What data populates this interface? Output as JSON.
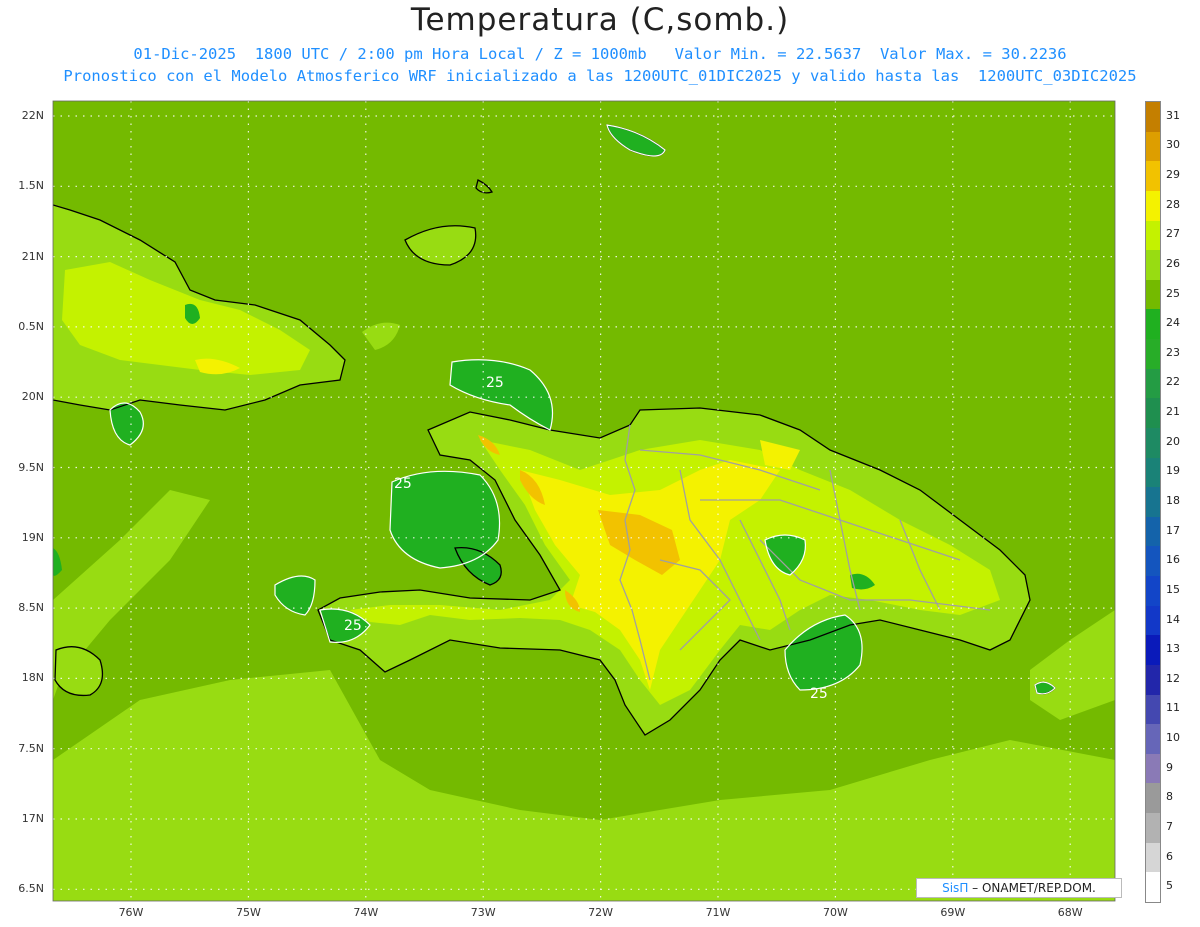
{
  "title": "Temperatura (C,somb.)",
  "subtitle_line1": "01-Dic-2025  1800 UTC / 2:00 pm Hora Local / Z = 1000mb   Valor Min. = 22.5637  Valor Max. = 30.2236",
  "subtitle_line2": "Pronostico con el Modelo Atmosferico WRF inicializado a las 1200UTC_01DIC2025 y valido hasta las  1200UTC_03DIC2025",
  "lat_labels": [
    "22N",
    "1.5N",
    "21N",
    "0.5N",
    "20N",
    "9.5N",
    "19N",
    "8.5N",
    "18N",
    "7.5N",
    "17N",
    "6.5N"
  ],
  "lon_labels": [
    "76W",
    "75W",
    "74W",
    "73W",
    "72W",
    "71W",
    "70W",
    "69W",
    "68W"
  ],
  "colorbar": {
    "labels": [
      "31",
      "30",
      "29",
      "28",
      "27",
      "26",
      "25",
      "24",
      "23",
      "22",
      "21",
      "20",
      "19",
      "18",
      "17",
      "16",
      "15",
      "14",
      "13",
      "12",
      "11",
      "10",
      "9",
      "8",
      "7",
      "6",
      "5"
    ],
    "colors": [
      "#c47f00",
      "#dd9e00",
      "#f2c200",
      "#f4f200",
      "#c4f200",
      "#98dc12",
      "#74ba00",
      "#20b020",
      "#28ad28",
      "#249c44",
      "#1f8f4f",
      "#1e8a63",
      "#1a8277",
      "#177490",
      "#1463aa",
      "#1455be",
      "#1245c8",
      "#1238c8",
      "#0a1aba",
      "#2226aa",
      "#4448b0",
      "#6666b8",
      "#8a7ab6",
      "#9a9a9a",
      "#b2b2b2",
      "#d6d6d6",
      "#ffffff"
    ]
  },
  "contour_labels": [
    "25",
    "25",
    "25",
    "25"
  ],
  "colors": {
    "sea": "#74ba00",
    "land_warm": "#98dc12",
    "land_hot": "#c4f200",
    "peak": "#f4f200",
    "peak_hot": "#f2c200",
    "cool": "#20b020",
    "coast": "#000000",
    "border": "#a0a0a0",
    "grid": "#ffffff"
  },
  "credit": {
    "brand": "SisΠ",
    "text": " – ONAMET/REP.DOM."
  }
}
